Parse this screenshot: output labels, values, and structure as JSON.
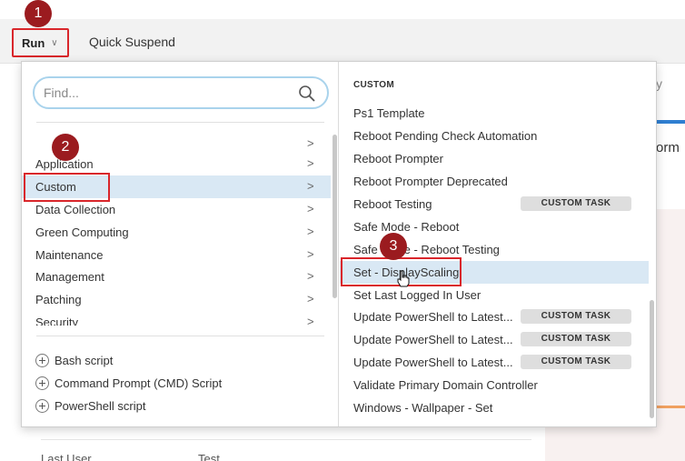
{
  "toolbar": {
    "run_label": "Run",
    "quick_suspend_label": "Quick Suspend"
  },
  "background": {
    "partial_tab": "y",
    "partial_heading": "orm",
    "row_last_user_label": "Last User",
    "row_last_user_value": "Test"
  },
  "search": {
    "placeholder": "Find..."
  },
  "categories": [
    {
      "label": "Application"
    },
    {
      "label": "Custom"
    },
    {
      "label": "Data Collection"
    },
    {
      "label": "Green Computing"
    },
    {
      "label": "Maintenance"
    },
    {
      "label": "Management"
    },
    {
      "label": "Patching"
    },
    {
      "label": "Security"
    }
  ],
  "scripts": [
    {
      "label": "Bash script"
    },
    {
      "label": "Command Prompt (CMD) Script"
    },
    {
      "label": "PowerShell script"
    }
  ],
  "right": {
    "heading": "CUSTOM",
    "badge_text": "CUSTOM TASK",
    "tasks": [
      {
        "label": "Ps1 Template"
      },
      {
        "label": "Reboot Pending Check Automation"
      },
      {
        "label": "Reboot Prompter"
      },
      {
        "label": "Reboot Prompter Deprecated"
      },
      {
        "label": "Reboot Testing"
      },
      {
        "label": "Safe Mode - Reboot"
      },
      {
        "label": "Safe Mode - Reboot Testing"
      },
      {
        "label": "Set - DisplayScaling"
      },
      {
        "label": "Set Last Logged In User"
      },
      {
        "label": "Update PowerShell to Latest..."
      },
      {
        "label": "Update PowerShell to Latest..."
      },
      {
        "label": "Update PowerShell to Latest..."
      },
      {
        "label": "Validate Primary Domain Controller"
      },
      {
        "label": "Windows - Wallpaper - Set"
      }
    ]
  },
  "steps": [
    "1",
    "2",
    "3"
  ],
  "colors": {
    "highlight_red": "#d9262b",
    "step_marker": "#9b1b1f",
    "selection": "#d9e8f4",
    "badge": "#dedede"
  }
}
